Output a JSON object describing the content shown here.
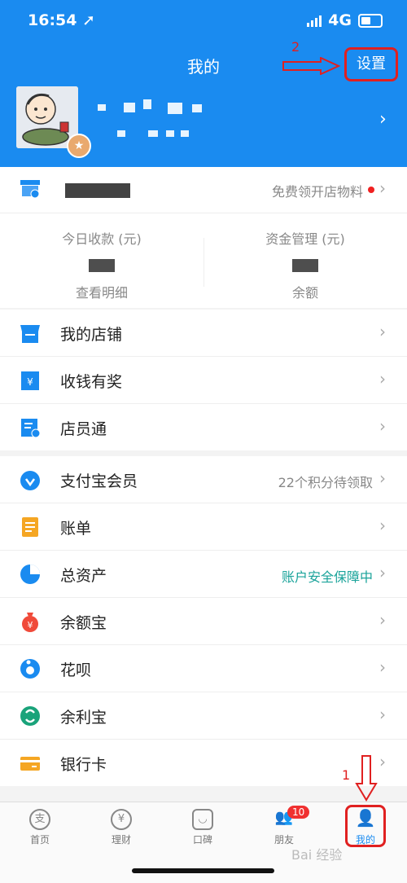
{
  "status_bar": {
    "time": "16:54 ➚",
    "network": "4G"
  },
  "header": {
    "title": "我的",
    "settings_label": "设置"
  },
  "annotations": {
    "settings_step": "2",
    "mine_step": "1"
  },
  "merchant": {
    "promo": "免费领开店物料"
  },
  "stats": {
    "today_label": "今日收款 (元)",
    "today_sub": "查看明细",
    "funds_label": "资金管理 (元)",
    "funds_sub": "余额"
  },
  "store_menu": [
    {
      "label": "我的店铺",
      "icon": "store-icon"
    },
    {
      "label": "收钱有奖",
      "icon": "gift-envelope-icon"
    },
    {
      "label": "店员通",
      "icon": "staff-card-icon"
    }
  ],
  "main_menu": [
    {
      "label": "支付宝会员",
      "icon": "member-icon",
      "extra": "22个积分待领取",
      "extra_color": "#888888"
    },
    {
      "label": "账单",
      "icon": "bill-icon"
    },
    {
      "label": "总资产",
      "icon": "pie-chart-icon",
      "extra": "账户安全保障中",
      "extra_color": "#1aa39a"
    },
    {
      "label": "余额宝",
      "icon": "money-bag-icon"
    },
    {
      "label": "花呗",
      "icon": "huabei-icon"
    },
    {
      "label": "余利宝",
      "icon": "yulibao-icon"
    },
    {
      "label": "银行卡",
      "icon": "bank-card-icon"
    }
  ],
  "tabs": [
    {
      "label": "首页",
      "glyph": "支"
    },
    {
      "label": "理财",
      "glyph": "¥"
    },
    {
      "label": "口碑",
      "glyph": "◡"
    },
    {
      "label": "朋友",
      "glyph": "👥",
      "badge": "10"
    },
    {
      "label": "我的",
      "glyph": "👤",
      "active": true
    }
  ],
  "colors": {
    "brand_blue": "#1a8bf0",
    "annotation_red": "#e02020"
  },
  "watermark": "Bai 经验"
}
